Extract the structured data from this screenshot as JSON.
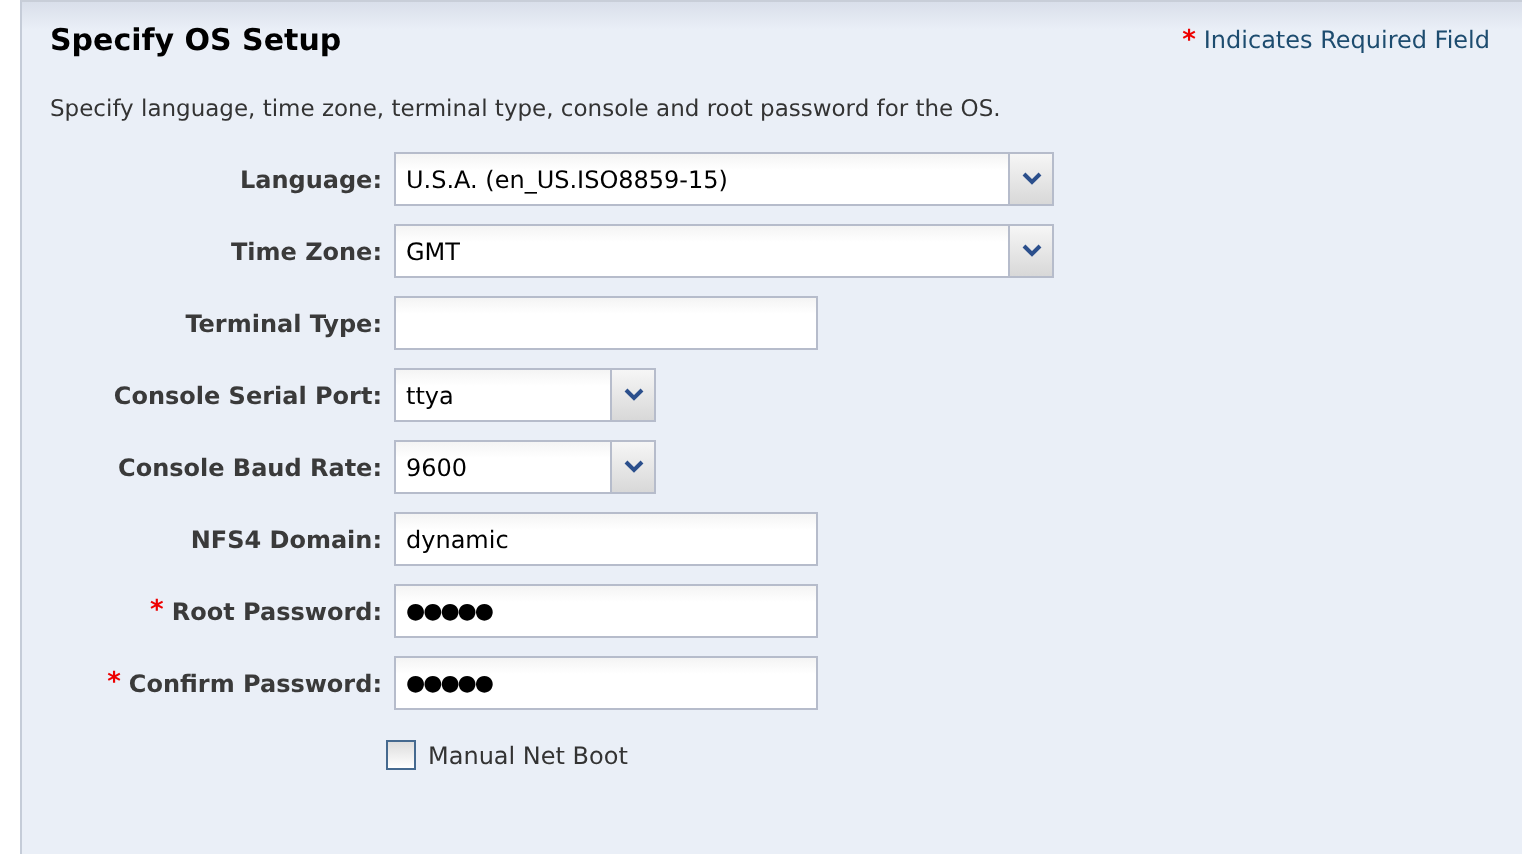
{
  "panel": {
    "title": "Specify OS Setup",
    "required_note": {
      "marker": "*",
      "text": "Indicates Required Field"
    },
    "description": "Specify language, time zone, terminal type, console and root password for the OS."
  },
  "fields": [
    {
      "label": "Language:",
      "kind": "select",
      "required": false,
      "value": "U.S.A. (en_US.ISO8859-15)"
    },
    {
      "label": "Time Zone:",
      "kind": "select",
      "required": false,
      "value": "GMT"
    },
    {
      "label": "Terminal Type:",
      "kind": "text",
      "required": false
    },
    {
      "label": "Console Serial Port:",
      "kind": "select",
      "required": false,
      "value": "ttya"
    },
    {
      "label": "Console Baud Rate:",
      "kind": "select",
      "required": false,
      "value": "9600"
    },
    {
      "label": "NFS4 Domain:",
      "kind": "text",
      "required": false,
      "value": "dynamic"
    },
    {
      "label": "Root Password:",
      "kind": "password",
      "required": true,
      "value": "●●●●●"
    },
    {
      "label": "Confirm Password:",
      "kind": "password",
      "required": true,
      "value": "●●●●●"
    }
  ],
  "checkbox": {
    "label": "Manual Net Boot",
    "checked": false
  }
}
